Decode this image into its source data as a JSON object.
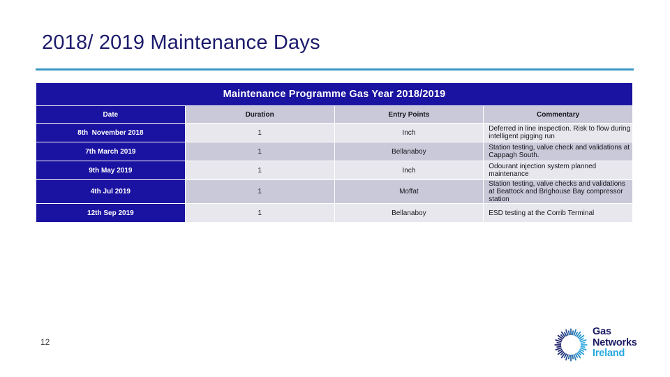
{
  "slide": {
    "title": "2018/ 2019 Maintenance Days",
    "page_number": "12",
    "accent_rule_color": "#3d98c4",
    "navy_color": "#1a12a0",
    "title_color": "#1c1a6b"
  },
  "table": {
    "banner": "Maintenance Programme Gas Year 2018/2019",
    "columns": [
      "Date",
      "Duration",
      "Entry Points",
      "Commentary"
    ],
    "rows": [
      {
        "date": "8th  November 2018",
        "duration": "1",
        "entry_points": "Inch",
        "commentary": "Deferred in line inspection. Risk to flow during intelligent pigging run"
      },
      {
        "date": "7th March 2019",
        "duration": "1",
        "entry_points": "Bellanaboy",
        "commentary": "Station testing, valve check and validations at Cappagh South."
      },
      {
        "date": "9th May 2019",
        "duration": "1",
        "entry_points": "Inch",
        "commentary": "Odourant injection system planned maintenance"
      },
      {
        "date": "4th Jul 2019",
        "duration": "1",
        "entry_points": "Moffat",
        "commentary": "Station testing, valve checks and validations at Beattock and Brighouse Bay compressor station"
      },
      {
        "date": "12th Sep 2019",
        "duration": "1",
        "entry_points": "Bellanaboy",
        "commentary": "ESD testing at the Corrib Terminal"
      }
    ]
  },
  "logo": {
    "line1": "Gas",
    "line2": "Networks",
    "line3": "Ireland",
    "mark_icon": "radial-burst-ring-icon",
    "dark_color": "#1b1b63",
    "accent_color": "#28a8e0"
  }
}
